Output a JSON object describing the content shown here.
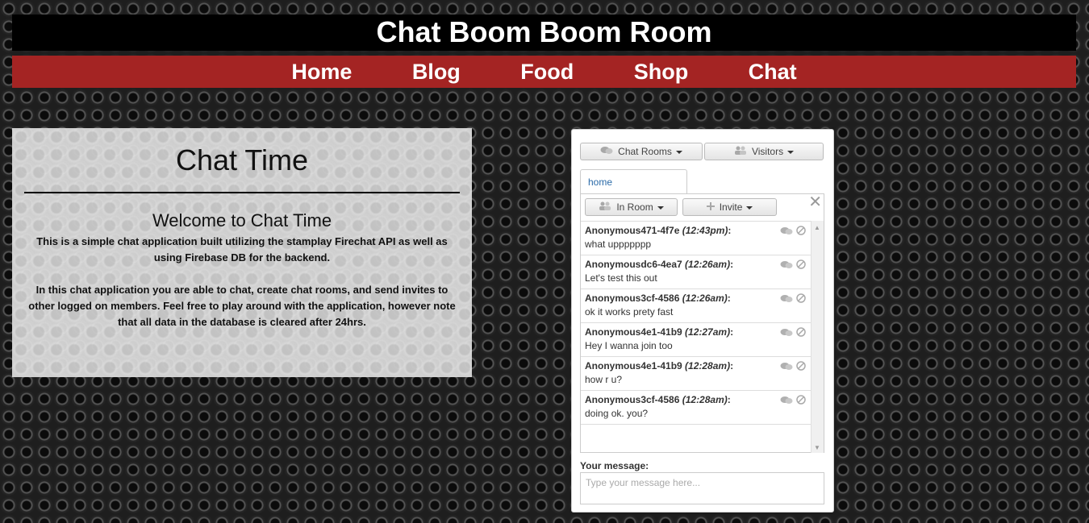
{
  "header": {
    "title": "Chat Boom Boom Room"
  },
  "nav": {
    "items": [
      "Home",
      "Blog",
      "Food",
      "Shop",
      "Chat"
    ]
  },
  "info": {
    "title": "Chat Time",
    "subtitle": "Welcome to Chat Time",
    "paragraph1": "This is a simple chat application built utilizing the stamplay Firechat API as well as using Firebase DB for the backend.",
    "paragraph2": "In this chat application you are able to chat, create chat rooms, and send invites to other logged on members. Feel free to play around with the application, however note that all data in the database is cleared after 24hrs."
  },
  "chat": {
    "chat_rooms_label": "Chat Rooms",
    "visitors_label": "Visitors",
    "tab_label": "home",
    "in_room_label": "In Room",
    "invite_label": "Invite",
    "close_glyph": "✕",
    "messages": [
      {
        "user": "Anonymous471-4f7e",
        "time": "(12:43pm)",
        "text": "what uppppppp"
      },
      {
        "user": "Anonymousdc6-4ea7",
        "time": "(12:26am)",
        "text": "Let's test this out"
      },
      {
        "user": "Anonymous3cf-4586",
        "time": "(12:26am)",
        "text": "ok it works prety fast"
      },
      {
        "user": "Anonymous4e1-41b9",
        "time": "(12:27am)",
        "text": "Hey I wanna join too"
      },
      {
        "user": "Anonymous4e1-41b9",
        "time": "(12:28am)",
        "text": "how r u?"
      },
      {
        "user": "Anonymous3cf-4586",
        "time": "(12:28am)",
        "text": "doing ok. you?"
      }
    ],
    "message_label": "Your message:",
    "message_placeholder": "Type your message here..."
  },
  "icons": {
    "chat_bubbles": "chat-bubbles-icon",
    "users": "users-icon",
    "plus": "plus-icon",
    "chevron_down": "chevron-down-icon",
    "close": "close-icon",
    "mute": "mute-icon",
    "block": "block-icon"
  },
  "colors": {
    "nav_bg": "#a42423",
    "header_bg": "#000000",
    "tab_text": "#2a6aa8"
  }
}
